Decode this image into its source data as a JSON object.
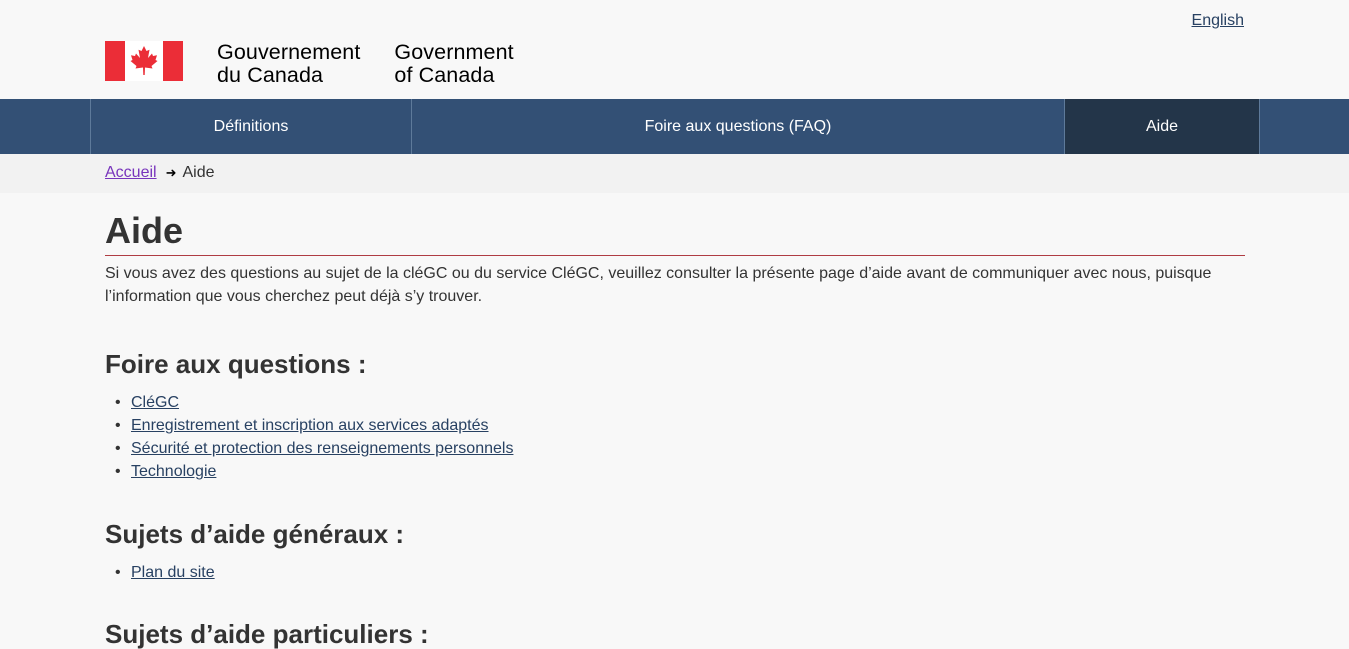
{
  "header": {
    "language_link": "English",
    "signature_fr_line1": "Gouvernement",
    "signature_fr_line2": "du Canada",
    "signature_en_line1": "Government",
    "signature_en_line2": "of Canada",
    "flag_colors": {
      "red": "#eb2d37",
      "white": "#ffffff"
    }
  },
  "nav": {
    "items": [
      {
        "label": "Définitions"
      },
      {
        "label": "Foire aux questions (FAQ)"
      },
      {
        "label": "Aide",
        "active": true
      }
    ]
  },
  "breadcrumb": {
    "home": "Accueil",
    "current": "Aide"
  },
  "main": {
    "title": "Aide",
    "intro": "Si vous avez des questions au sujet de la cléGC ou du service CléGC, veuillez consulter la présente page d’aide avant de communiquer avec nous, puisque l’information que vous cherchez peut déjà s’y trouver.",
    "faq_heading": "Foire aux questions :",
    "faq_links": [
      "CléGC",
      "Enregistrement et inscription aux services adaptés",
      "Sécurité et protection des renseignements personnels",
      "Technologie"
    ],
    "general_heading": "Sujets d’aide généraux :",
    "general_links": [
      "Plan du site"
    ],
    "particular_heading": "Sujets d’aide particuliers :"
  },
  "colors": {
    "nav_bg": "#335075",
    "nav_active_bg": "#233549",
    "link": "#284162",
    "visited_link": "#7834bc",
    "title_rule": "#af3c43"
  }
}
